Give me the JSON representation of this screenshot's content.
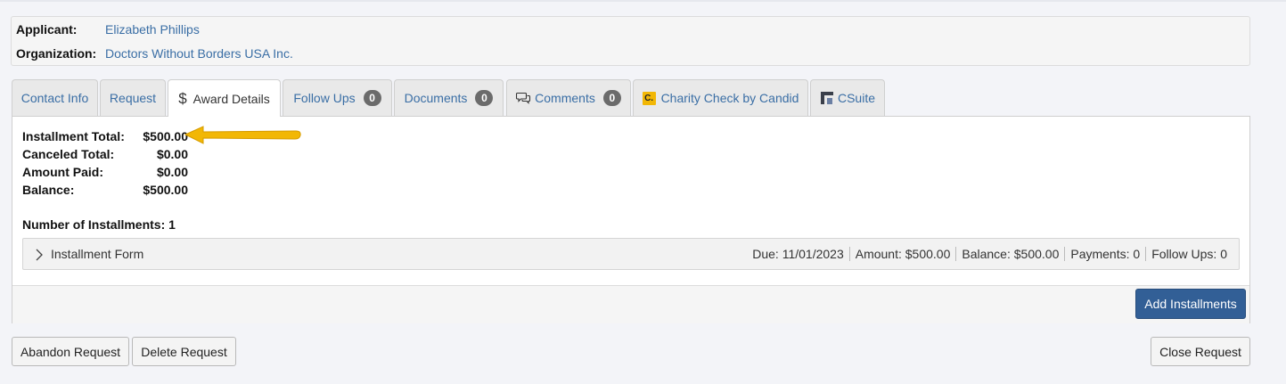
{
  "applicant": {
    "label": "Applicant:",
    "value": "Elizabeth Phillips"
  },
  "organization": {
    "label": "Organization:",
    "value": "Doctors Without Borders USA Inc."
  },
  "tabs": [
    {
      "label": "Contact Info",
      "active": false
    },
    {
      "label": "Request",
      "active": false
    },
    {
      "label": "Award Details",
      "active": true,
      "icon": "dollar-icon"
    },
    {
      "label": "Follow Ups",
      "badge": "0",
      "active": false
    },
    {
      "label": "Documents",
      "badge": "0",
      "active": false
    },
    {
      "label": "Comments",
      "badge": "0",
      "active": false,
      "icon": "comments-icon"
    },
    {
      "label": "Charity Check by Candid",
      "active": false,
      "icon": "candid-icon",
      "icon_text": "C."
    },
    {
      "label": "CSuite",
      "active": false,
      "icon": "csuite-icon"
    }
  ],
  "summary": {
    "installment_total_label": "Installment Total:",
    "installment_total_value": "$500.00",
    "canceled_total_label": "Canceled Total:",
    "canceled_total_value": "$0.00",
    "amount_paid_label": "Amount Paid:",
    "amount_paid_value": "$0.00",
    "balance_label": "Balance:",
    "balance_value": "$500.00",
    "num_installments": "Number of Installments: 1"
  },
  "installment": {
    "title": "Installment Form",
    "due": "Due: 11/01/2023",
    "amount": "Amount: $500.00",
    "balance": "Balance: $500.00",
    "payments": "Payments: 0",
    "follow_ups": "Follow Ups: 0"
  },
  "buttons": {
    "add_installments": "Add Installments",
    "abandon_request": "Abandon Request",
    "delete_request": "Delete Request",
    "close_request": "Close Request"
  },
  "colors": {
    "link": "#3a6ea5",
    "primary_button": "#325f96",
    "badge": "#6b6b6b",
    "annotation_arrow": "#f2b705"
  }
}
